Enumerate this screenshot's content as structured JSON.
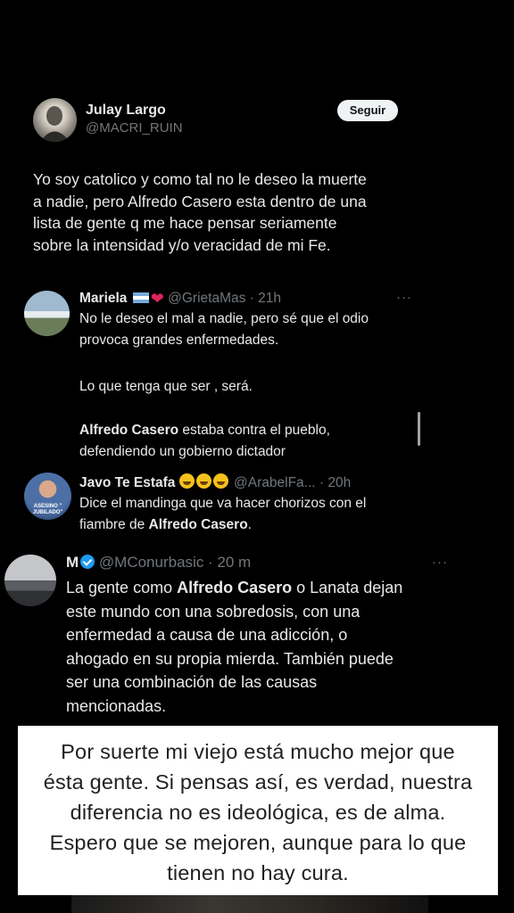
{
  "main_tweet": {
    "name": "Julay Largo",
    "handle": "@MACRI_RUIN",
    "follow_label": "Seguir",
    "lines": [
      "Yo soy catolico y como tal no le deseo la muerte",
      "a nadie, pero Alfredo Casero esta dentro de una",
      "lista  de gente  q me hace pensar seriamente",
      "sobre la intensidad y/o veracidad  de mi Fe."
    ]
  },
  "reply1": {
    "name": "Mariela",
    "meta": "@GrietaMas · 21h",
    "more": "···",
    "para1": [
      "No le deseo el mal a nadie, pero sé que el odio",
      "provoca grandes enfermedades."
    ],
    "para2": "Lo que tenga que ser , será.",
    "para3_bold": "Alfredo Casero",
    "para3_rest": " estaba contra el pueblo,",
    "para3_line2": "defendiendo un gobierno dictador"
  },
  "reply2": {
    "name": "Javo Te Estafa",
    "meta": "@ArabelFa... · 20h",
    "avatar_caption": "ASESINO \" JUBILADO\"",
    "line1": "Dice el mandinga que va hacer chorizos con el",
    "line2_pre": "fiambre de ",
    "line2_bold": "Alfredo Casero",
    "line2_post": "."
  },
  "reply3": {
    "name": "M",
    "meta": "@MConurbasic · 20 m",
    "more": "···",
    "line1_pre": "La gente como ",
    "line1_bold": "Alfredo Casero",
    "line1_post": " o Lanata dejan",
    "lines": [
      "este mundo con una sobredosis, con una",
      "enfermedad a causa de una adicción, o",
      "ahogado en su propia mierda. También puede",
      "ser una combinación de las causas",
      "mencionadas."
    ]
  },
  "caption": {
    "lines": [
      "Por suerte mi viejo está mucho mejor que",
      "ésta gente. Si pensas así, es verdad, nuestra",
      "diferencia no es ideológica, es de alma.",
      "Espero que se mejoren, aunque para lo que",
      "tienen no hay cura."
    ]
  },
  "colors": {
    "background": "#000000",
    "muted": "#71767b",
    "verified": "#1d9bf0",
    "heart": "#e0245e"
  },
  "icons": [
    "verified-badge-icon",
    "argentina-flag-icon",
    "heart-icon",
    "laughing-emoji-icon",
    "more-options-icon"
  ]
}
